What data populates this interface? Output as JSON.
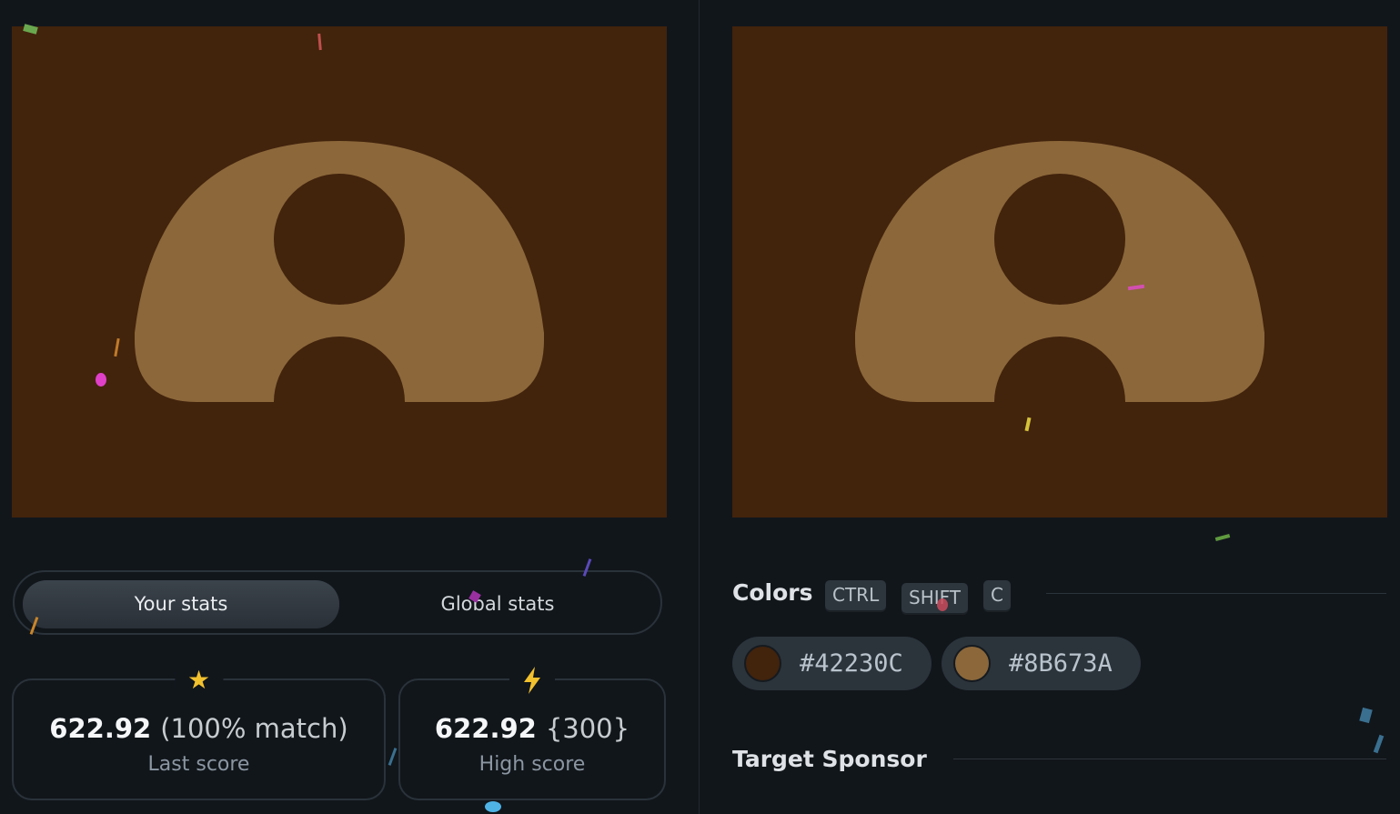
{
  "colors": {
    "background": "#42230C",
    "shape": "#8B673A",
    "star": "#F2C12E",
    "bolt": "#F2C12E"
  },
  "stats_toggle": {
    "your_stats": "Your stats",
    "global_stats": "Global stats",
    "active": "Your stats"
  },
  "last_score": {
    "icon": "star-icon",
    "value": "622.92",
    "detail": "(100% match)",
    "label": "Last score"
  },
  "high_score": {
    "icon": "lightning-bolt-icon",
    "value": "622.92",
    "detail": "{300}",
    "label": "High score"
  },
  "colors_section": {
    "title": "Colors",
    "shortcut_keys": [
      "CTRL",
      "SHIFT",
      "C"
    ],
    "swatches": [
      {
        "hex": "#42230C",
        "color": "#42230C"
      },
      {
        "hex": "#8B673A",
        "color": "#8B673A"
      }
    ]
  },
  "target_sponsor": {
    "title": "Target Sponsor"
  }
}
